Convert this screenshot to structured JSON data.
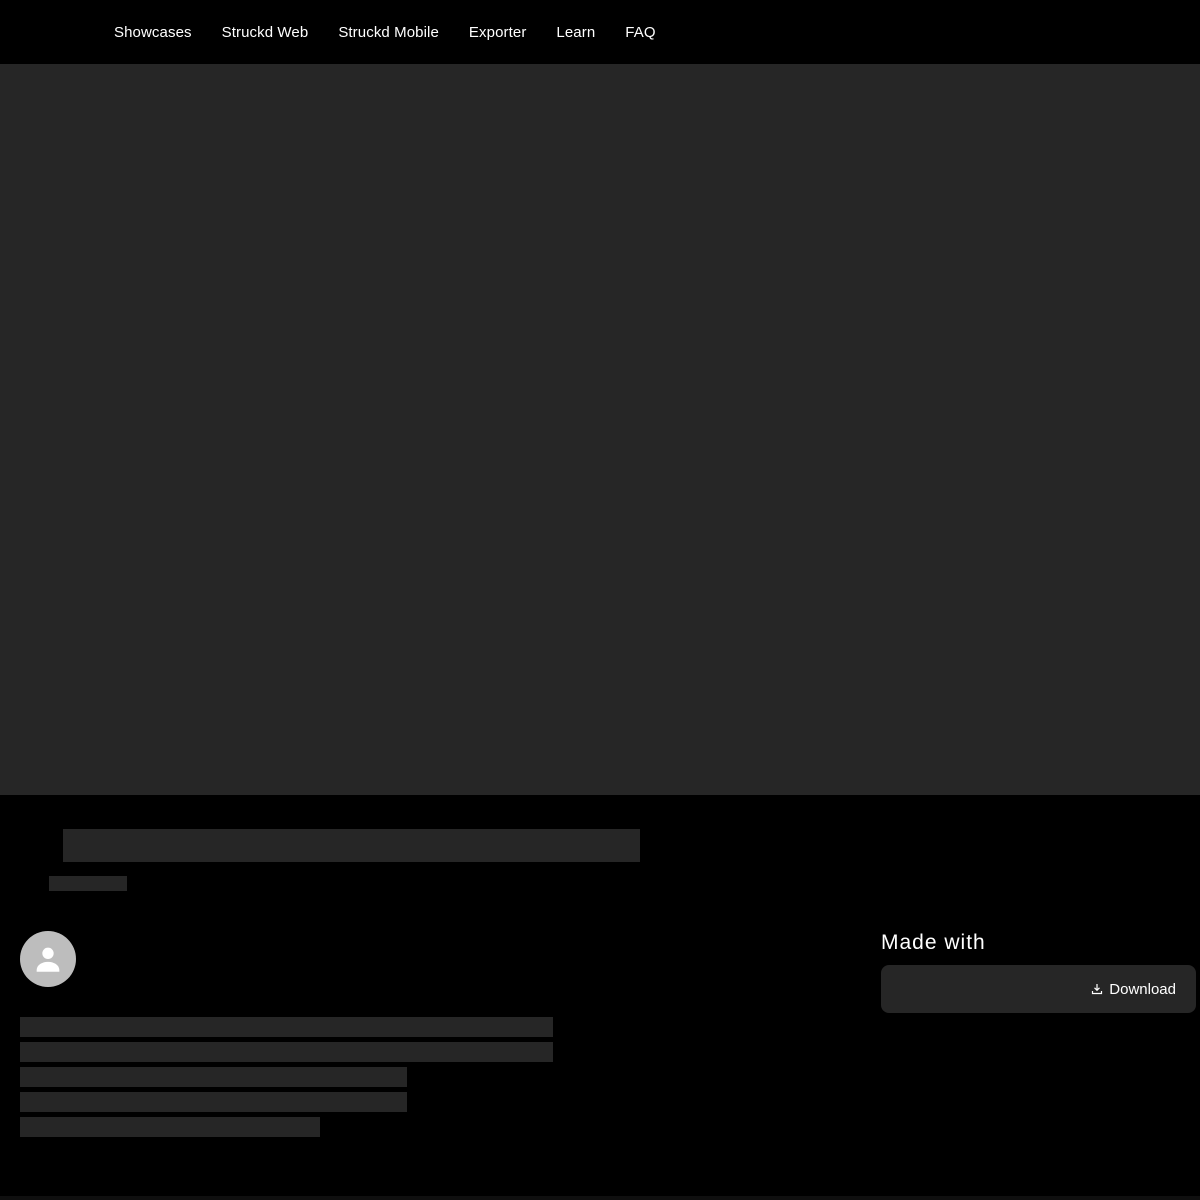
{
  "nav": {
    "items": [
      {
        "label": "Showcases"
      },
      {
        "label": "Struckd Web"
      },
      {
        "label": "Struckd Mobile"
      },
      {
        "label": "Exporter"
      },
      {
        "label": "Learn"
      },
      {
        "label": "FAQ"
      }
    ]
  },
  "sidebar": {
    "made_with_label": "Made with",
    "download_label": "Download",
    "download_icon": "download-icon"
  },
  "colors": {
    "background": "#000000",
    "placeholder": "#262626",
    "avatar": "#bdbdbd",
    "text": "#ffffff"
  }
}
